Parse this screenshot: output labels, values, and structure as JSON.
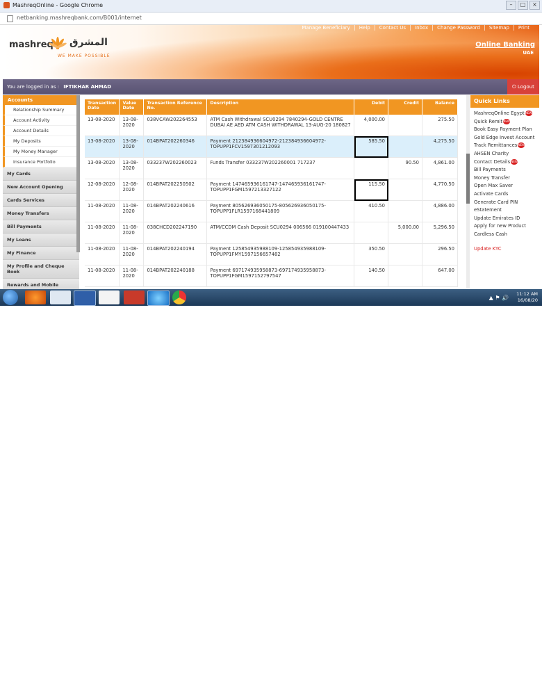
{
  "window": {
    "title": "MashreqOnline - Google Chrome",
    "url": "netbanking.mashreqbank.com/B001/internet",
    "buttons": [
      "–",
      "□",
      "×"
    ]
  },
  "header": {
    "logo_en": "mashreq",
    "logo_ar": "المشرق",
    "tagline": "WE MAKE POSSIBLE",
    "topnav": [
      "Manage Beneficiary",
      "Help",
      "Contact Us",
      "Inbox",
      "Change Password",
      "Sitemap",
      "Print"
    ],
    "title": "Online Banking",
    "subtitle": "UAE"
  },
  "session": {
    "logged_label": "You are logged in as :",
    "user": "IFTIKHAR AHMAD",
    "logout": "Logout"
  },
  "sidebar": {
    "accounts_label": "Accounts",
    "sub_items": [
      "Relationship Summary",
      "Account Activity",
      "Account Details",
      "My Deposits",
      "My Money Manager",
      "Insurance Portfolio"
    ],
    "sections": [
      "My Cards",
      "New Account Opening",
      "Cards Services",
      "Money Transfers",
      "Bill Payments",
      "My Loans",
      "My Finance",
      "My Profile and Cheque Book",
      "Rewards and Mobile"
    ]
  },
  "table": {
    "headers": [
      "Transaction Date",
      "Value Date",
      "Transaction Reference No.",
      "Description",
      "Debit",
      "Credit",
      "Balance"
    ],
    "rows": [
      {
        "tdate": "13-08-2020",
        "vdate": "13-08-2020",
        "ref": "038VCAW202264553",
        "desc": "ATM Cash Withdrawal SCU0294 7840294-GOLD CENTRE DUBAI AE AED ATM CASH WITHDRAWAL 13-AUG-20 180827",
        "debit": "4,000.00",
        "credit": "",
        "balance": "275.50",
        "highlight": false,
        "boxed": false
      },
      {
        "tdate": "13-08-2020",
        "vdate": "13-08-2020",
        "ref": "014BPAT202260346",
        "desc": "Payment 212384936604972-212384936604972-TOPUPP1FCV1597301212093",
        "debit": "585.50",
        "credit": "",
        "balance": "4,275.50",
        "highlight": true,
        "boxed": true
      },
      {
        "tdate": "13-08-2020",
        "vdate": "13-08-2020",
        "ref": "033237W202260023",
        "desc": "Funds Transfer 033237W202260001 717237",
        "debit": "",
        "credit": "90.50",
        "balance": "4,861.00",
        "highlight": false,
        "boxed": false
      },
      {
        "tdate": "12-08-2020",
        "vdate": "12-08-2020",
        "ref": "014BPAT202250502",
        "desc": "Payment 147465936161747-147465936161747-TOPUPP1FGM1597213327122",
        "debit": "115.50",
        "credit": "",
        "balance": "4,770.50",
        "highlight": false,
        "boxed": true
      },
      {
        "tdate": "11-08-2020",
        "vdate": "11-08-2020",
        "ref": "014BPAT202240616",
        "desc": "Payment 805626936050175-805626936050175-TOPUPP1FLR1597168441809",
        "debit": "410.50",
        "credit": "",
        "balance": "4,886.00",
        "highlight": false,
        "boxed": false
      },
      {
        "tdate": "11-08-2020",
        "vdate": "11-08-2020",
        "ref": "038CHCD202247190",
        "desc": "ATM/CCDM Cash Deposit SCU0294 006566 019100447433",
        "debit": "",
        "credit": "5,000.00",
        "balance": "5,296.50",
        "highlight": false,
        "boxed": false
      },
      {
        "tdate": "11-08-2020",
        "vdate": "11-08-2020",
        "ref": "014BPAT202240194",
        "desc": "Payment 125854935988109-125854935988109-TOPUPP1FMY1597156657482",
        "debit": "350.50",
        "credit": "",
        "balance": "296.50",
        "highlight": false,
        "boxed": false
      },
      {
        "tdate": "11-08-2020",
        "vdate": "11-08-2020",
        "ref": "014BPAT202240188",
        "desc": "Payment 697174935958873-697174935958873-TOPUPP1FGM1597152797547",
        "debit": "140.50",
        "credit": "",
        "balance": "647.00",
        "highlight": false,
        "boxed": false
      }
    ]
  },
  "quick_links": {
    "title": "Quick Links",
    "new_badge": "NEW",
    "items": [
      {
        "label": "MashreqOnline Egypt",
        "new": true
      },
      {
        "label": "Quick Remit",
        "new": true
      },
      {
        "label": "Book Easy Payment Plan",
        "new": false
      },
      {
        "label": "Gold Edge Invest Account",
        "new": false
      },
      {
        "label": "Track Remittances",
        "new": true
      },
      {
        "label": "AHSEN Charity",
        "new": false
      },
      {
        "label": "Contact Details",
        "new": true
      },
      {
        "label": "Bill Payments",
        "new": false
      },
      {
        "label": "Money Transfer",
        "new": false
      },
      {
        "label": "Open Max Saver",
        "new": false
      },
      {
        "label": "Activate Cards",
        "new": false
      },
      {
        "label": "Generate Card PIN",
        "new": false
      },
      {
        "label": "eStatement",
        "new": false
      },
      {
        "label": "Update Emirates ID",
        "new": false
      },
      {
        "label": "Apply for new Product",
        "new": false
      },
      {
        "label": "Cardless Cash",
        "new": false
      }
    ],
    "kyc": "Update KYC"
  },
  "taskbar": {
    "time": "11:12 AM",
    "date": "16/08/20",
    "apps": [
      "firefox-icon",
      "notepad-icon",
      "word-icon",
      "acrobat-icon",
      "presentation-icon",
      "ie-icon",
      "chrome-icon"
    ]
  },
  "colors": {
    "accent": "#f19622",
    "logout": "#d8413a",
    "highlight": "#dbeffb",
    "purple_bar": "#605a7a"
  }
}
